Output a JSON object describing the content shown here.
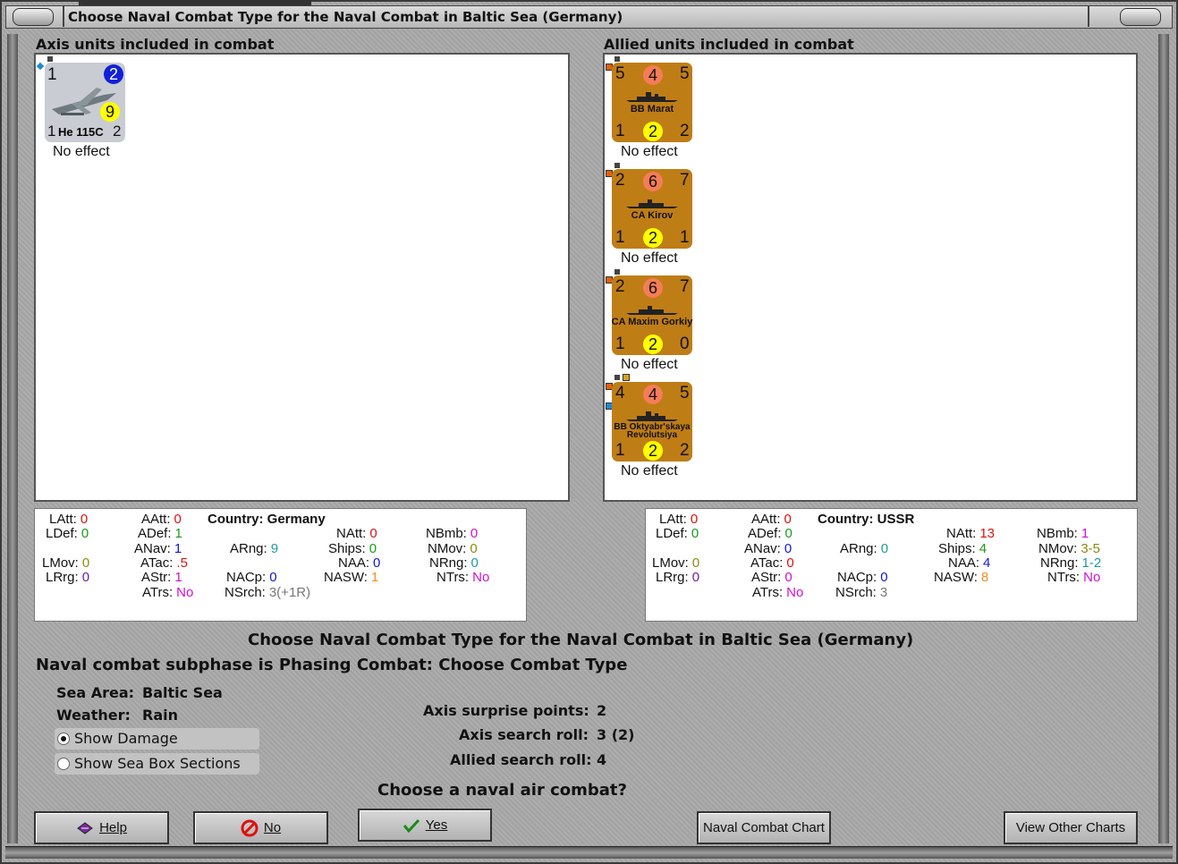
{
  "window": {
    "title": "Choose Naval Combat Type for the Naval Combat in Baltic Sea (Germany)"
  },
  "axis": {
    "heading": "Axis units included in combat",
    "units": [
      {
        "name": "He 115C",
        "top_left": "1",
        "top_right": "2",
        "mid_right": "9",
        "bottom_left": "1",
        "bottom_right": "2",
        "effect": "No effect"
      }
    ],
    "stats": {
      "country_label": "Country: Germany",
      "latt": {
        "label": "LAtt:",
        "value": "0"
      },
      "ldef": {
        "label": "LDef:",
        "value": "0"
      },
      "lmov": {
        "label": "LMov:",
        "value": "0"
      },
      "lrrg": {
        "label": "LRrg:",
        "value": "0"
      },
      "aatt": {
        "label": "AAtt:",
        "value": "0"
      },
      "adef": {
        "label": "ADef:",
        "value": "1"
      },
      "anav": {
        "label": "ANav:",
        "value": "1"
      },
      "atac": {
        "label": "ATac:",
        "value": ".5"
      },
      "astr": {
        "label": "AStr:",
        "value": "1"
      },
      "atrs": {
        "label": "ATrs:",
        "value": "No"
      },
      "arng": {
        "label": "ARng:",
        "value": "9"
      },
      "nacp": {
        "label": "NACp:",
        "value": "0"
      },
      "nsrch": {
        "label": "NSrch:",
        "value": "3(+1R)"
      },
      "natt": {
        "label": "NAtt:",
        "value": "0"
      },
      "ships": {
        "label": "Ships:",
        "value": "0"
      },
      "naa": {
        "label": "NAA:",
        "value": "0"
      },
      "nasw": {
        "label": "NASW:",
        "value": "1"
      },
      "nbmb": {
        "label": "NBmb:",
        "value": "0"
      },
      "nmov": {
        "label": "NMov:",
        "value": "0"
      },
      "nrng": {
        "label": "NRng:",
        "value": "0"
      },
      "ntrs": {
        "label": "NTrs:",
        "value": "No"
      }
    }
  },
  "allied": {
    "heading": "Allied units included in combat",
    "units": [
      {
        "name": "BB Marat",
        "tl": "5",
        "tc": "4",
        "tr": "5",
        "bl": "1",
        "bc": "2",
        "br": "2",
        "effect": "No effect"
      },
      {
        "name": "CA Kirov",
        "tl": "2",
        "tc": "6",
        "tr": "7",
        "bl": "1",
        "bc": "2",
        "br": "1",
        "effect": "No effect"
      },
      {
        "name": "CA Maxim Gorkiy",
        "tl": "2",
        "tc": "6",
        "tr": "7",
        "bl": "1",
        "bc": "2",
        "br": "0",
        "effect": "No effect"
      },
      {
        "name": "BB Oktyabr'skaya Revolutsiya",
        "tl": "4",
        "tc": "4",
        "tr": "5",
        "bl": "1",
        "bc": "2",
        "br": "2",
        "effect": "No effect"
      }
    ],
    "stats": {
      "country_label": "Country: USSR",
      "latt": {
        "label": "LAtt:",
        "value": "0"
      },
      "ldef": {
        "label": "LDef:",
        "value": "0"
      },
      "lmov": {
        "label": "LMov:",
        "value": "0"
      },
      "lrrg": {
        "label": "LRrg:",
        "value": "0"
      },
      "aatt": {
        "label": "AAtt:",
        "value": "0"
      },
      "adef": {
        "label": "ADef:",
        "value": "0"
      },
      "anav": {
        "label": "ANav:",
        "value": "0"
      },
      "atac": {
        "label": "ATac:",
        "value": "0"
      },
      "astr": {
        "label": "AStr:",
        "value": "0"
      },
      "atrs": {
        "label": "ATrs:",
        "value": "No"
      },
      "arng": {
        "label": "ARng:",
        "value": "0"
      },
      "nacp": {
        "label": "NACp:",
        "value": "0"
      },
      "nsrch": {
        "label": "NSrch:",
        "value": "3"
      },
      "natt": {
        "label": "NAtt:",
        "value": "13"
      },
      "ships": {
        "label": "Ships:",
        "value": "4"
      },
      "naa": {
        "label": "NAA:",
        "value": "4"
      },
      "nasw": {
        "label": "NASW:",
        "value": "8"
      },
      "nbmb": {
        "label": "NBmb:",
        "value": "1"
      },
      "nmov": {
        "label": "NMov:",
        "value": "3-5"
      },
      "nrng": {
        "label": "NRng:",
        "value": "1-2"
      },
      "ntrs": {
        "label": "NTrs:",
        "value": "No"
      }
    }
  },
  "info": {
    "heading": "Choose Naval Combat Type for the Naval Combat in Baltic Sea (Germany)",
    "subphase": "Naval combat subphase is Phasing Combat: Choose Combat Type",
    "sea_area_label": "Sea Area:",
    "sea_area_value": "Baltic Sea",
    "weather_label": "Weather:",
    "weather_value": "Rain",
    "axis_surprise_label": "Axis surprise points:",
    "axis_surprise_value": "2",
    "axis_search_label": "Axis search roll:",
    "axis_search_value": "3 (2)",
    "allied_search_label": "Allied search roll:",
    "allied_search_value": "4",
    "question": "Choose a naval air combat?"
  },
  "options": {
    "show_damage": {
      "label": "Show Damage",
      "selected": true
    },
    "show_sea_box": {
      "label": "Show Sea Box Sections",
      "selected": false
    }
  },
  "buttons": {
    "help": "Help",
    "no": "No",
    "yes": "Yes",
    "naval_chart": "Naval Combat Chart",
    "other_charts": "View Other Charts"
  },
  "colors": {
    "counter_ussr": "#bf7d16",
    "counter_germany_air": "#c9ccd2",
    "frame_gray": "#a9a9a9"
  }
}
